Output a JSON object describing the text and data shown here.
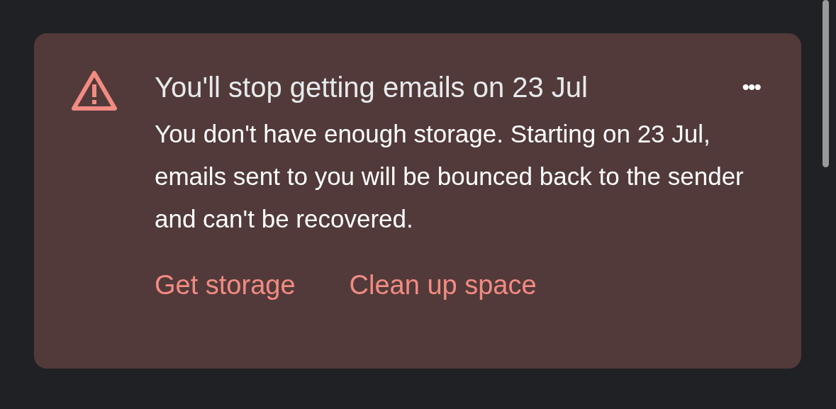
{
  "banner": {
    "title": "You'll stop getting emails on 23 Jul",
    "menu": "•••",
    "message": "You don't have enough storage. Starting on 23 Jul, emails sent to you will be bounced back to the sender and can't be recovered.",
    "actions": [
      "Get storage",
      "Clean up space"
    ]
  }
}
